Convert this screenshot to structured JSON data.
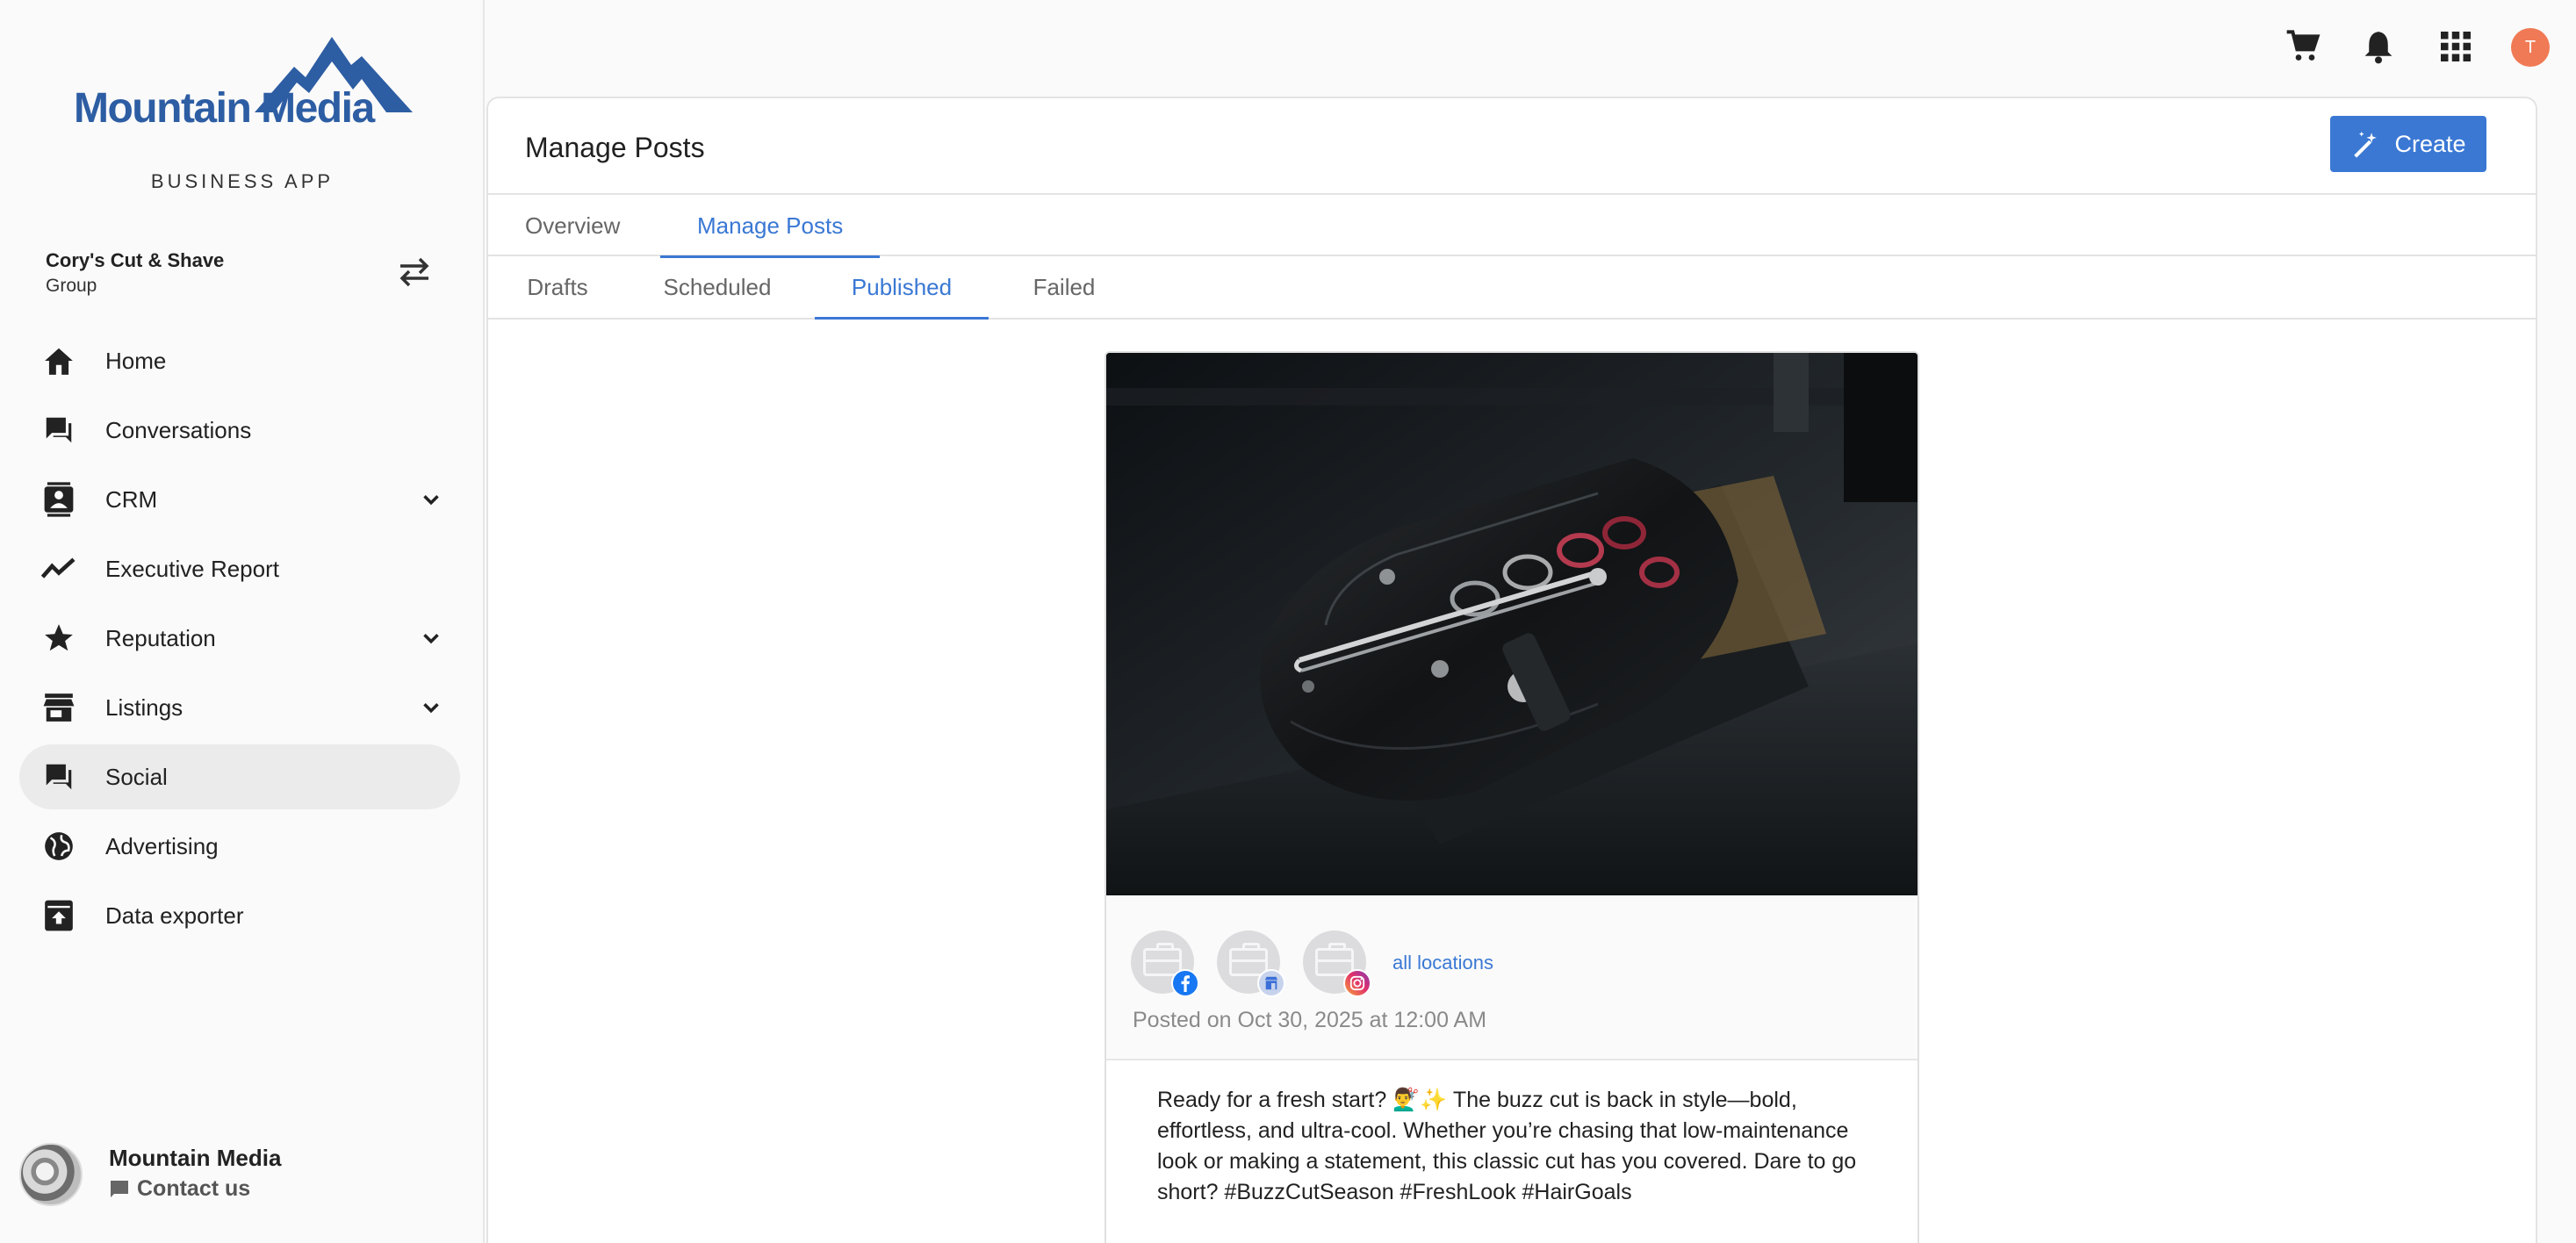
{
  "brand": {
    "logo_text": "Mountain Media",
    "app_label": "BUSINESS APP",
    "color": "#2d5da3"
  },
  "account": {
    "name": "Cory's Cut & Shave",
    "type": "Group"
  },
  "nav": {
    "items": [
      {
        "label": "Home",
        "icon": "home-icon",
        "expandable": false,
        "active": false
      },
      {
        "label": "Conversations",
        "icon": "chat-icon",
        "expandable": false,
        "active": false
      },
      {
        "label": "CRM",
        "icon": "contact-card-icon",
        "expandable": true,
        "active": false
      },
      {
        "label": "Executive Report",
        "icon": "trend-line-icon",
        "expandable": false,
        "active": false
      },
      {
        "label": "Reputation",
        "icon": "star-icon",
        "expandable": true,
        "active": false
      },
      {
        "label": "Listings",
        "icon": "storefront-icon",
        "expandable": true,
        "active": false
      },
      {
        "label": "Social",
        "icon": "forum-icon",
        "expandable": false,
        "active": true
      },
      {
        "label": "Advertising",
        "icon": "globe-icon",
        "expandable": false,
        "active": false
      },
      {
        "label": "Data exporter",
        "icon": "archive-upload-icon",
        "expandable": false,
        "active": false
      }
    ]
  },
  "footer": {
    "name": "Mountain Media",
    "contact_label": "Contact us"
  },
  "topbar": {
    "icons": [
      "cart-icon",
      "bell-icon",
      "apps-grid-icon"
    ],
    "user_initial": "T",
    "user_color": "#f07a55"
  },
  "page": {
    "title": "Manage Posts",
    "create_label": "Create",
    "accent": "#3a78d4"
  },
  "tabs": [
    {
      "label": "Overview",
      "active": false
    },
    {
      "label": "Manage Posts",
      "active": true
    }
  ],
  "subtabs": [
    {
      "label": "Drafts",
      "active": false
    },
    {
      "label": "Scheduled",
      "active": false
    },
    {
      "label": "Published",
      "active": true
    },
    {
      "label": "Failed",
      "active": false
    }
  ],
  "post": {
    "networks": [
      "facebook",
      "google-business",
      "instagram"
    ],
    "all_locations": "all locations",
    "posted_on": "Posted on Oct 30, 2025 at 12:00 AM",
    "body": "Ready for a fresh start? 💇‍♂️✨ The buzz cut is back in style—bold, effortless, and ultra-cool. Whether you’re chasing that low-maintenance look or making a statement, this classic cut has you covered. Dare to go short? #BuzzCutSeason #FreshLook #HairGoals"
  }
}
